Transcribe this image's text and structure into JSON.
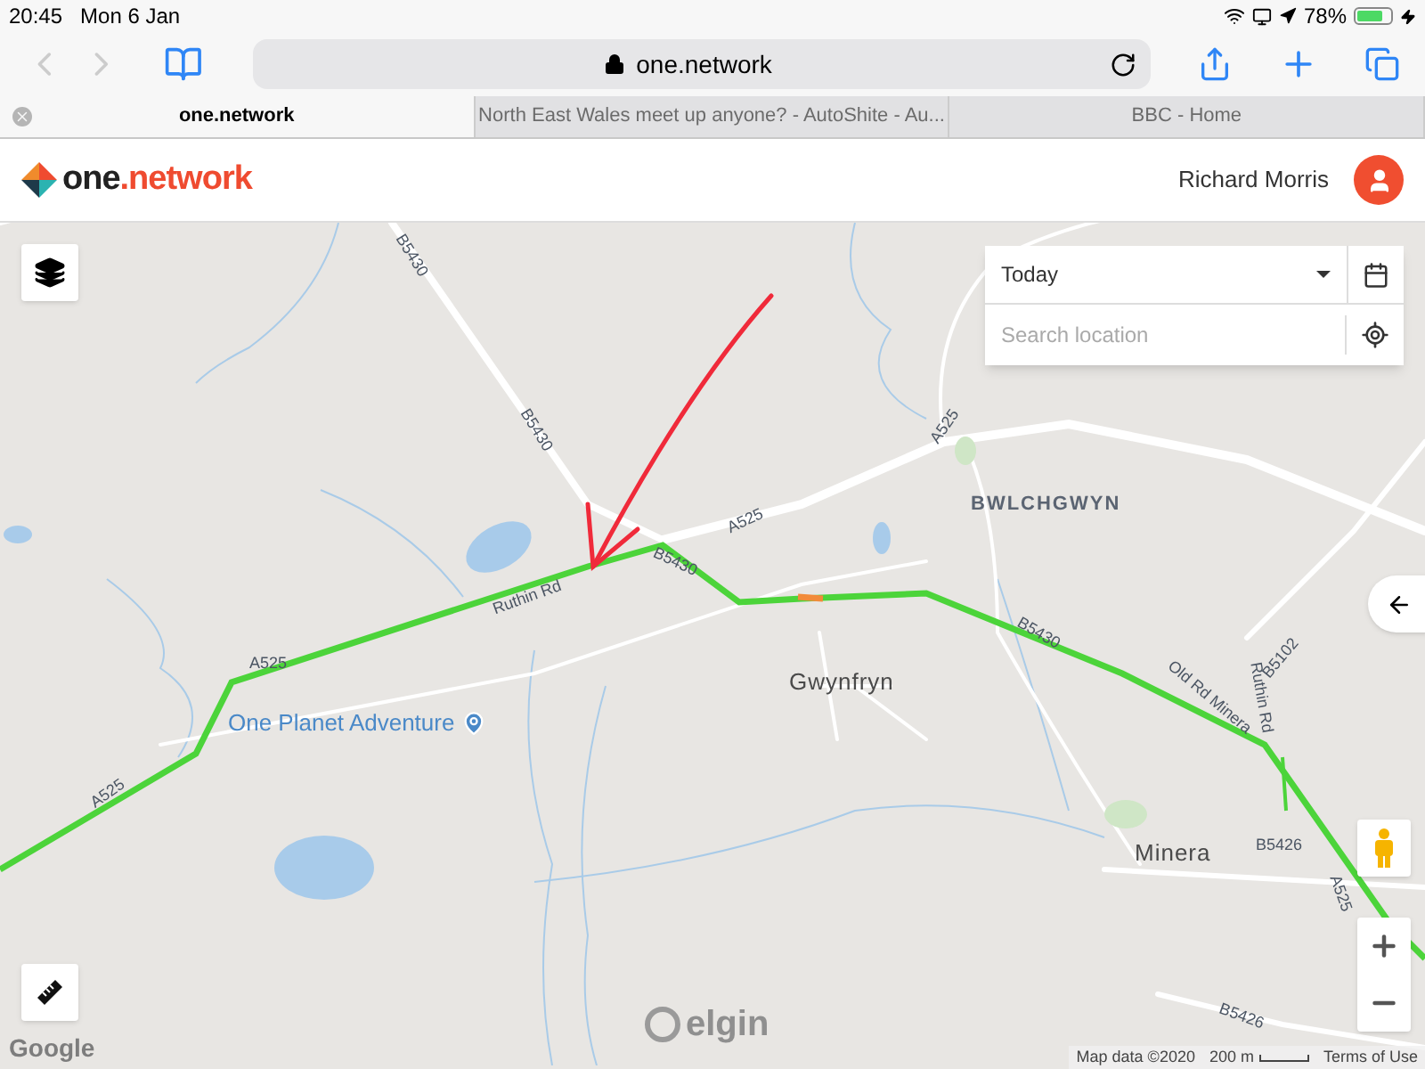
{
  "status_bar": {
    "time": "20:45",
    "date": "Mon 6 Jan",
    "battery": "78%"
  },
  "browser": {
    "url": "one.network",
    "tabs": [
      {
        "title": "one.network",
        "selected": true
      },
      {
        "title": "North East Wales meet up anyone? - AutoShite - Au...",
        "selected": false
      },
      {
        "title": "BBC - Home",
        "selected": false
      }
    ]
  },
  "header": {
    "logo": [
      "one",
      ".network"
    ],
    "user": "Richard Morris"
  },
  "panel": {
    "date_select": "Today",
    "search": {
      "placeholder": "Search location"
    }
  },
  "map_labels": [
    {
      "text": "B5430",
      "kind": "road"
    },
    {
      "text": "B5430",
      "kind": "road"
    },
    {
      "text": "A525",
      "kind": "road"
    },
    {
      "text": "BWLCHGWYN",
      "kind": "town"
    },
    {
      "text": "A525",
      "kind": "road"
    },
    {
      "text": "B5430",
      "kind": "road"
    },
    {
      "text": "Ruthin Rd",
      "kind": "road"
    },
    {
      "text": "A525",
      "kind": "road"
    },
    {
      "text": "One Planet Adventure",
      "kind": "poi"
    },
    {
      "text": "A525",
      "kind": "road"
    },
    {
      "text": "Gwynfryn",
      "kind": "place"
    },
    {
      "text": "B5430",
      "kind": "road"
    },
    {
      "text": "Old Rd Minera",
      "kind": "road"
    },
    {
      "text": "B5102",
      "kind": "road"
    },
    {
      "text": "Ruthin Rd",
      "kind": "road"
    },
    {
      "text": "Minera",
      "kind": "place"
    },
    {
      "text": "B5426",
      "kind": "road"
    },
    {
      "text": "A525",
      "kind": "road"
    },
    {
      "text": "B5426",
      "kind": "road"
    }
  ],
  "attribution": {
    "google": "Google",
    "watermark": "elgin",
    "map_data": "Map data ©2020",
    "scale": "200 m",
    "terms": "Terms of Use"
  }
}
